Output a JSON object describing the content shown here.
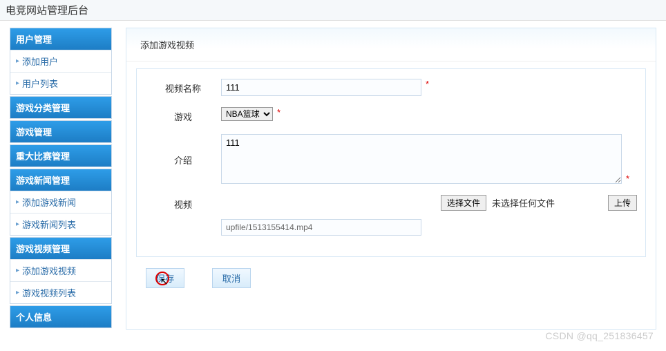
{
  "header": {
    "title": "电竞网站管理后台"
  },
  "sidebar": {
    "sections": [
      {
        "header": "用户管理",
        "items": [
          "添加用户",
          "用户列表"
        ]
      },
      {
        "header": "游戏分类管理",
        "items": []
      },
      {
        "header": "游戏管理",
        "items": []
      },
      {
        "header": "重大比赛管理",
        "items": []
      },
      {
        "header": "游戏新闻管理",
        "items": [
          "添加游戏新闻",
          "游戏新闻列表"
        ]
      },
      {
        "header": "游戏视频管理",
        "items": [
          "添加游戏视频",
          "游戏视频列表"
        ]
      },
      {
        "header": "个人信息",
        "items": []
      }
    ]
  },
  "main": {
    "title": "添加游戏视频",
    "fields": {
      "video_name": {
        "label": "视频名称",
        "value": "111",
        "required": "*"
      },
      "game": {
        "label": "游戏",
        "value": "NBA篮球",
        "required": "*"
      },
      "intro": {
        "label": "介绍",
        "value": "111",
        "required": "*"
      },
      "video": {
        "label": "视频",
        "choose_btn": "选择文件",
        "file_status": "未选择任何文件",
        "upload_btn": "上传",
        "path_value": "upfile/1513155414.mp4"
      }
    },
    "actions": {
      "save": "保存",
      "cancel": "取消"
    }
  },
  "watermark": "CSDN @qq_251836457"
}
